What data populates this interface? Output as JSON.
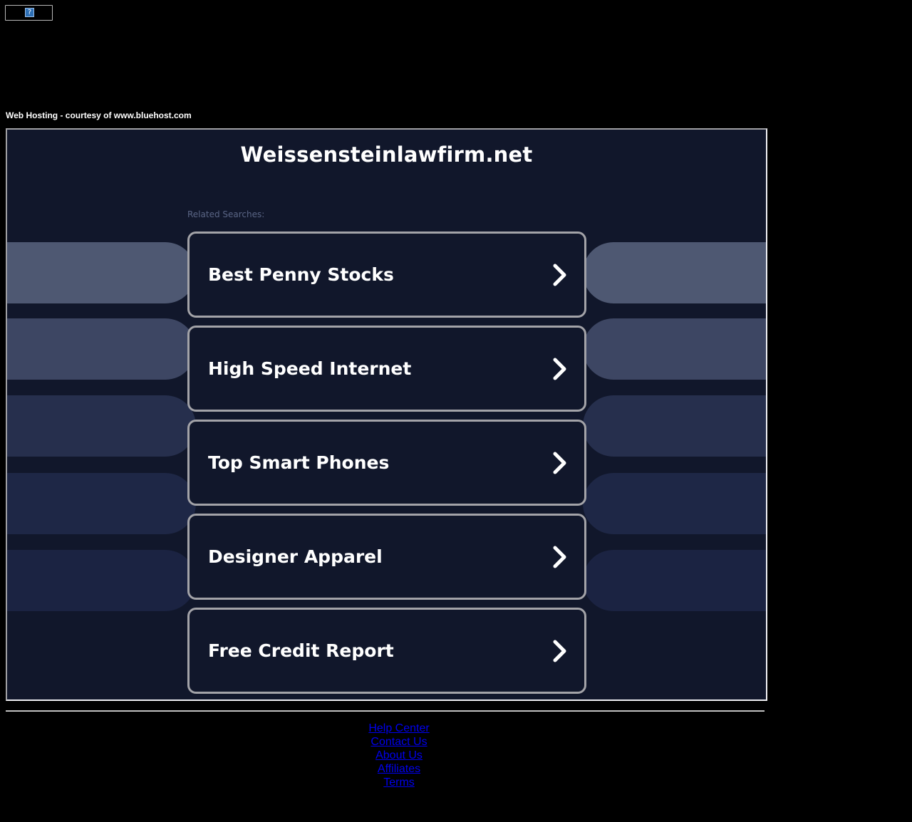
{
  "top_image": {
    "icon": "broken-image-question-icon",
    "glyph": "?"
  },
  "courtesy_text": "Web Hosting - courtesy of www.bluehost.com",
  "main": {
    "domain_title": "Weissensteinlawfirm.net",
    "related_label": "Related Searches:",
    "chevron_icon": "chevron-right-icon",
    "searches": [
      {
        "label": "Best Penny Stocks"
      },
      {
        "label": "High Speed Internet"
      },
      {
        "label": "Top Smart Phones"
      },
      {
        "label": "Designer Apparel"
      },
      {
        "label": "Free Credit Report"
      }
    ],
    "colors": {
      "background": "#11172b",
      "card_border": "#a3a3a8",
      "label_muted": "#5a6585",
      "bands": [
        "#4e5872",
        "#3d4663",
        "#262f4d",
        "#1e2746",
        "#1b2342"
      ]
    }
  },
  "footer": {
    "links": [
      {
        "label": "Help Center"
      },
      {
        "label": "Contact Us"
      },
      {
        "label": "About Us"
      },
      {
        "label": "Affiliates"
      },
      {
        "label": "Terms"
      }
    ],
    "link_color": "#0000ee"
  }
}
